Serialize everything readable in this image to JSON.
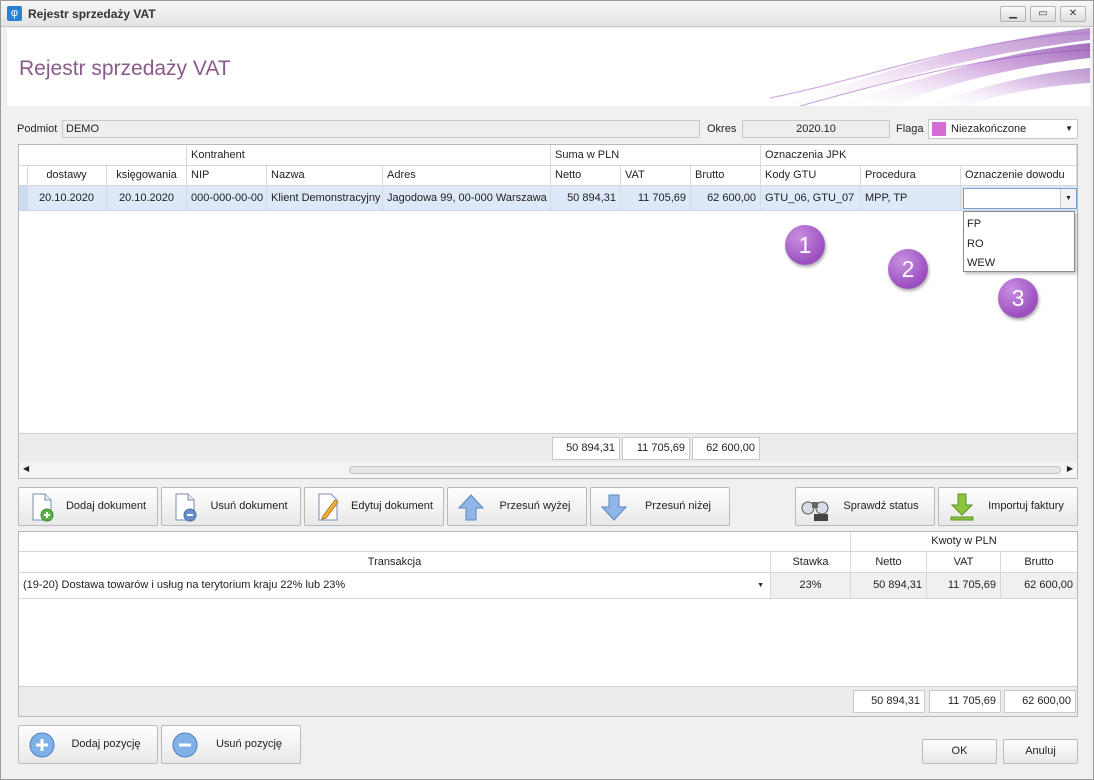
{
  "window": {
    "title": "Rejestr sprzedaży VAT",
    "app_icon": "φ"
  },
  "header": {
    "title": "Rejestr sprzedaży VAT"
  },
  "form": {
    "podmiot_label": "Podmiot",
    "podmiot_value": "DEMO",
    "okres_label": "Okres",
    "okres_value": "2020.10",
    "flaga_label": "Flaga",
    "flaga_value": "Niezakończone",
    "flaga_color": "#d66bd6"
  },
  "top_table": {
    "groups": {
      "kontrahent": "Kontrahent",
      "suma": "Suma w PLN",
      "jpk": "Oznaczenia JPK"
    },
    "columns": {
      "dostawy": "dostawy",
      "ksiegowania": "księgowania",
      "nip": "NIP",
      "nazwa": "Nazwa",
      "adres": "Adres",
      "netto": "Netto",
      "vat": "VAT",
      "brutto": "Brutto",
      "gtu": "Kody GTU",
      "procedura": "Procedura",
      "dowod": "Oznaczenie dowodu"
    },
    "row": {
      "dostawy": "20.10.2020",
      "ksiegowania": "20.10.2020",
      "nip": "000-000-00-00",
      "nazwa": "Klient Demonstracyjny",
      "adres": "Jagodowa 99, 00-000 Warszawa",
      "netto": "50 894,31",
      "vat": "11 705,69",
      "brutto": "62 600,00",
      "gtu": "GTU_06, GTU_07",
      "procedura": "MPP, TP",
      "dowod": ""
    },
    "dropdown_options": [
      "FP",
      "RO",
      "WEW"
    ],
    "totals": {
      "netto": "50 894,31",
      "vat": "11 705,69",
      "brutto": "62 600,00"
    }
  },
  "markers": [
    "1",
    "2",
    "3"
  ],
  "toolbar": {
    "add": "Dodaj dokument",
    "remove": "Usuń dokument",
    "edit": "Edytuj dokument",
    "up": "Przesuń wyżej",
    "down": "Przesuń niżej",
    "check_vat": "Sprawdź status VAT",
    "import": "Importuj faktury"
  },
  "bottom_table": {
    "group": "Kwoty w PLN",
    "columns": {
      "transakcja": "Transakcja",
      "stawka": "Stawka",
      "netto": "Netto",
      "vat": "VAT",
      "brutto": "Brutto"
    },
    "row": {
      "transakcja": "(19-20) Dostawa towarów i usług na terytorium kraju 22% lub 23%",
      "stawka": "23%",
      "netto": "50 894,31",
      "vat": "11 705,69",
      "brutto": "62 600,00"
    },
    "totals": {
      "netto": "50 894,31",
      "vat": "11 705,69",
      "brutto": "62 600,00"
    }
  },
  "bottom_buttons": {
    "add_position": "Dodaj pozycję",
    "remove_position": "Usuń pozycję",
    "ok": "OK",
    "cancel": "Anuluj"
  }
}
